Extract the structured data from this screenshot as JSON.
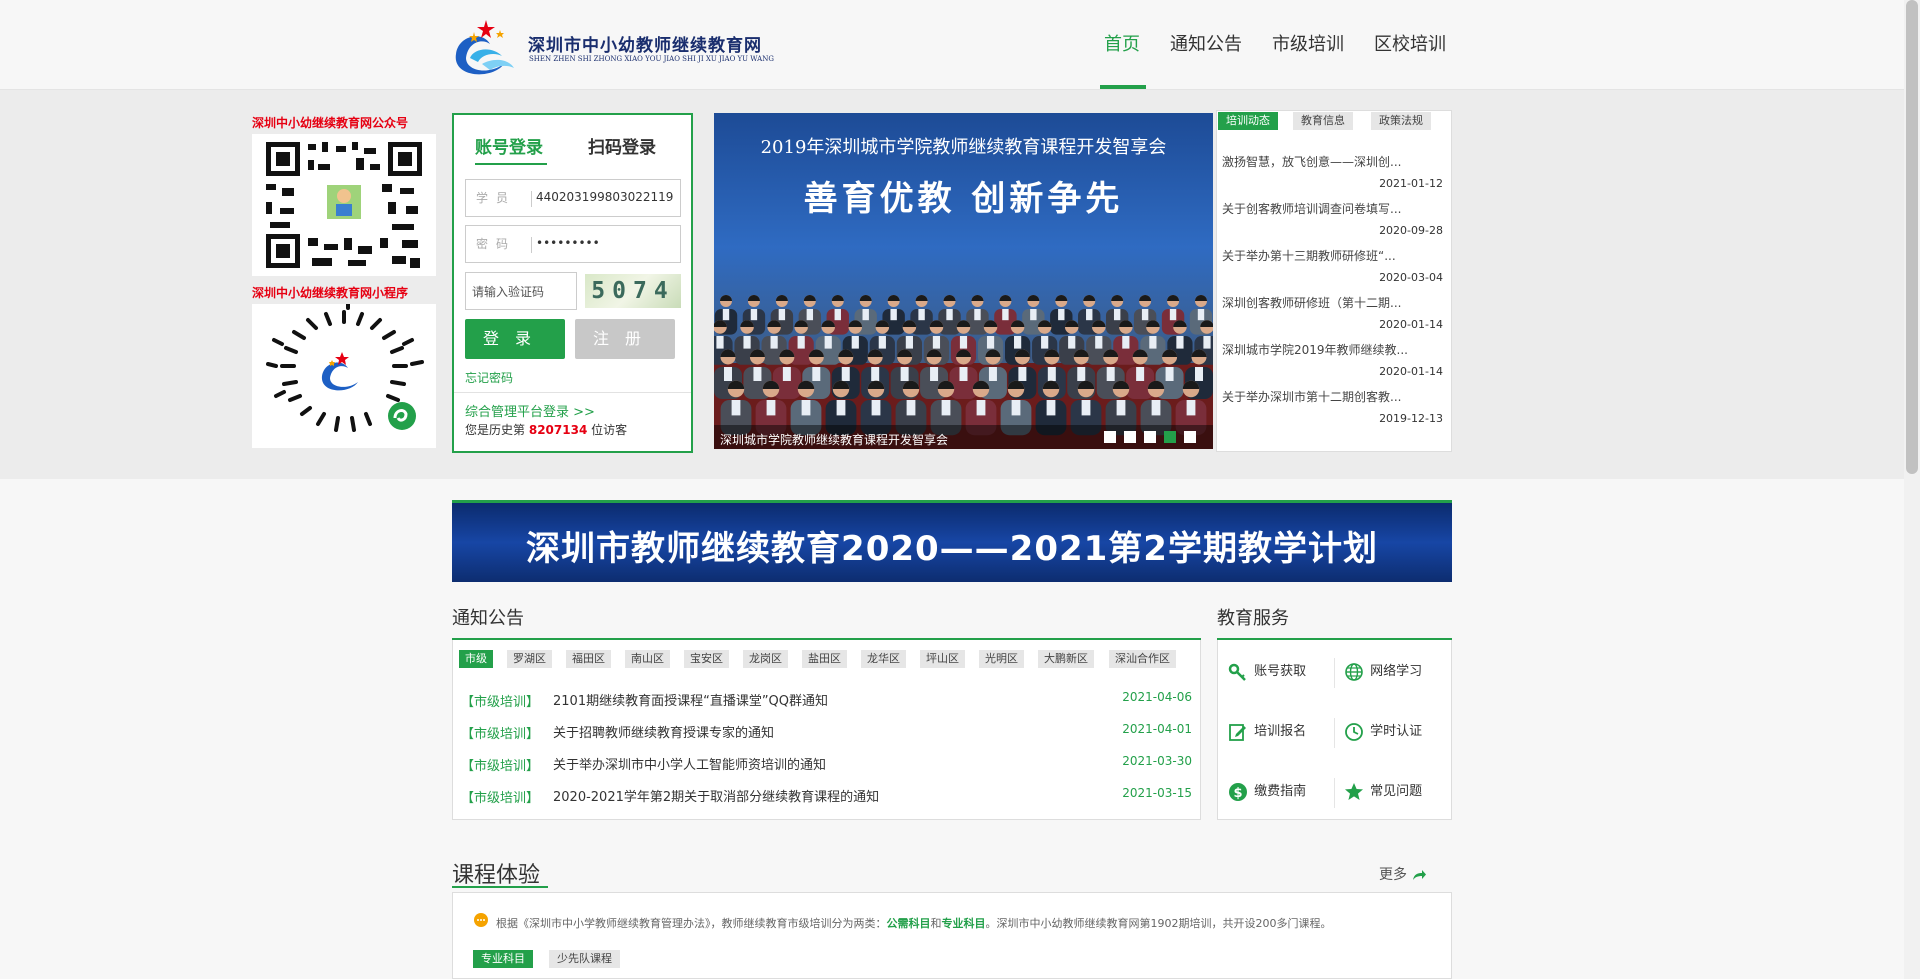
{
  "header": {
    "logo_title": "深圳市中小幼教师继续教育网",
    "logo_subtitle": "SHEN ZHEN SHI ZHONG XIAO YOU JIAO SHI JI XU JIAO YU WANG",
    "nav": [
      "首页",
      "通知公告",
      "市级培训",
      "区校培训"
    ]
  },
  "qr": {
    "wechat_label": "深圳中小幼继续教育网公众号",
    "miniprogram_label": "深圳中小幼继续教育网小程序"
  },
  "login": {
    "tab_account": "账号登录",
    "tab_scan": "扫码登录",
    "user_label": "学员",
    "user_value": "440203199803022119",
    "pass_label": "密码",
    "pass_value": "•••••••••",
    "captcha_placeholder": "请输入验证码",
    "captcha_code": "5074",
    "login_button": "登录",
    "register_button": "注册",
    "forgot": "忘记密码",
    "platform_link": "综合管理平台登录 >>",
    "visitor_prefix": "您是历史第",
    "visitor_count": "8207134",
    "visitor_suffix": "位访客"
  },
  "banner": {
    "title": "2019年深圳城市学院教师继续教育课程开发智享会",
    "slogan": "善育优教  创新争先",
    "caption": "深圳城市学院教师继续教育课程开发智享会",
    "active_slide": 4,
    "slide_count": 5
  },
  "news": {
    "tabs": [
      "培训动态",
      "教育信息",
      "政策法规"
    ],
    "items": [
      {
        "title": "激扬智慧，放飞创意——深圳创...",
        "date": "2021-01-12"
      },
      {
        "title": "关于创客教师培训调查问卷填写...",
        "date": "2020-09-28"
      },
      {
        "title": "关于举办第十三期教师研修班“...",
        "date": "2020-03-04"
      },
      {
        "title": "深圳创客教师研修班（第十二期...",
        "date": "2020-01-14"
      },
      {
        "title": "深圳城市学院2019年教师继续教...",
        "date": "2020-01-14"
      },
      {
        "title": "关于举办深圳市第十二期创客教...",
        "date": "2019-12-13"
      }
    ]
  },
  "plan": {
    "text": "深圳市教师继续教育2020——2021第2学期教学计划"
  },
  "notices": {
    "title": "通知公告",
    "districts": [
      "市级",
      "罗湖区",
      "福田区",
      "南山区",
      "宝安区",
      "龙岗区",
      "盐田区",
      "龙华区",
      "坪山区",
      "光明区",
      "大鹏新区",
      "深汕合作区"
    ],
    "items": [
      {
        "tag": "【市级培训】",
        "text": "2101期继续教育面授课程“直播课堂”QQ群通知",
        "date": "2021-04-06"
      },
      {
        "tag": "【市级培训】",
        "text": "关于招聘教师继续教育授课专家的通知",
        "date": "2021-04-01"
      },
      {
        "tag": "【市级培训】",
        "text": "关于举办深圳市中小学人工智能师资培训的通知",
        "date": "2021-03-30"
      },
      {
        "tag": "【市级培训】",
        "text": "2020-2021学年第2期关于取消部分继续教育课程的通知",
        "date": "2021-03-15"
      }
    ]
  },
  "services": {
    "title": "教育服务",
    "items": [
      {
        "label": "账号获取",
        "icon": "key-icon"
      },
      {
        "label": "网络学习",
        "icon": "globe-icon"
      },
      {
        "label": "培训报名",
        "icon": "edit-icon"
      },
      {
        "label": "学时认证",
        "icon": "clock-icon"
      },
      {
        "label": "缴费指南",
        "icon": "dollar-icon"
      },
      {
        "label": "常见问题",
        "icon": "star-icon"
      }
    ]
  },
  "courses": {
    "title": "课程体验",
    "more": "更多",
    "note_prefix": "根据《深圳市中小学教师继续教育管理办法》，教师继续教育市级培训分为两类：",
    "note_public": "公需科目",
    "note_and": "和",
    "note_pro": "专业科目",
    "note_suffix": "。深圳市中小幼教师继续教育网第1902期培训，共开设200多门课程。",
    "tabs": [
      "专业科目",
      "少先队课程"
    ]
  },
  "colors": {
    "accent": "#23a04a",
    "red": "#e60012",
    "navy": "#1a2e6e"
  }
}
